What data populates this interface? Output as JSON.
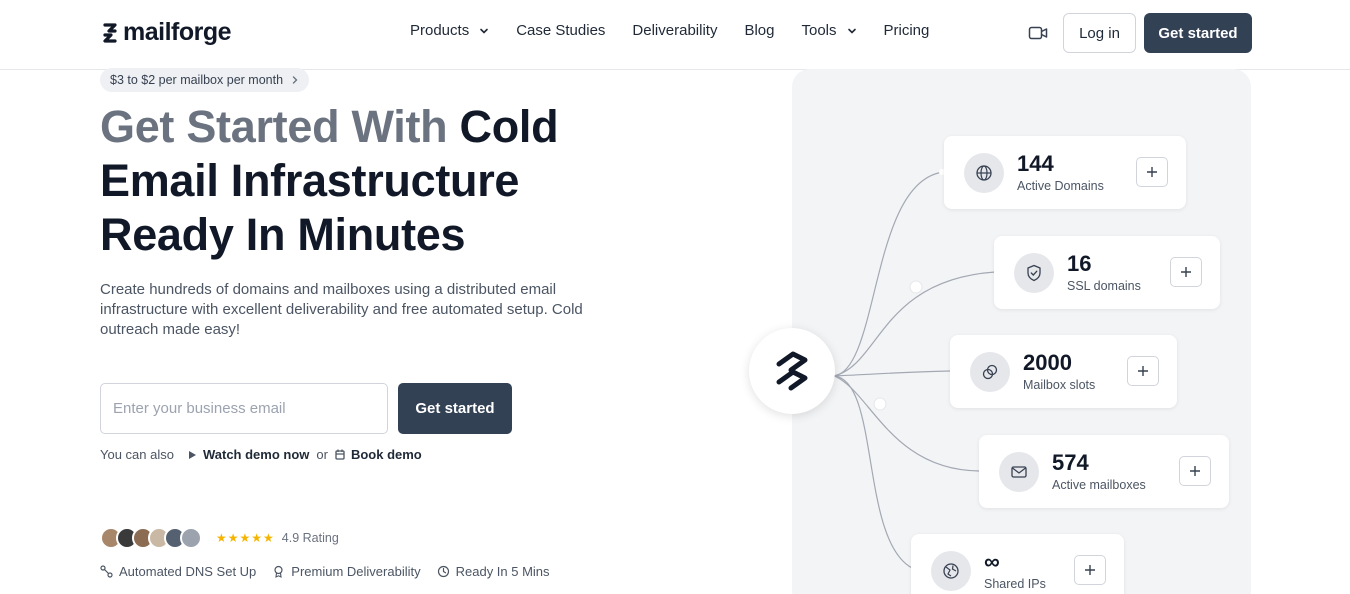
{
  "brand": {
    "name": "mailforge"
  },
  "nav": {
    "items": [
      {
        "label": "Products",
        "has_dropdown": true
      },
      {
        "label": "Case Studies",
        "has_dropdown": false
      },
      {
        "label": "Deliverability",
        "has_dropdown": false
      },
      {
        "label": "Blog",
        "has_dropdown": false
      },
      {
        "label": "Tools",
        "has_dropdown": true
      },
      {
        "label": "Pricing",
        "has_dropdown": false
      }
    ],
    "video_icon": "video-camera-icon",
    "login_label": "Log in",
    "cta_label": "Get started"
  },
  "hero": {
    "pill_text": "$3 to $2 per mailbox per month",
    "headline_muted": "Get Started With",
    "headline_rest": " Cold Email Infrastructure Ready In Minutes",
    "description": "Create hundreds of domains and mailboxes using a distributed email infrastructure with excellent deliverability and free automated setup. Cold outreach made easy!",
    "email_placeholder": "Enter your business email",
    "cta_label": "Get started",
    "also_text": "You can also",
    "watch_demo": "Watch demo now",
    "or_text": "or",
    "book_demo": "Book demo",
    "rating_text": "4.9 Rating",
    "stars": 5,
    "features": [
      {
        "icon": "dns-setup-icon",
        "label": "Automated DNS Set Up"
      },
      {
        "icon": "award-icon",
        "label": "Premium Deliverability"
      },
      {
        "icon": "clock-icon",
        "label": "Ready In 5 Mins"
      }
    ]
  },
  "stats": [
    {
      "icon": "globe-icon",
      "value": "144",
      "label": "Active Domains"
    },
    {
      "icon": "shield-check-icon",
      "value": "16",
      "label": "SSL domains"
    },
    {
      "icon": "mailbox-slots-icon",
      "value": "2000",
      "label": "Mailbox slots"
    },
    {
      "icon": "envelope-icon",
      "value": "574",
      "label": "Active mailboxes"
    },
    {
      "icon": "network-globe-icon",
      "value": "∞",
      "label": "Shared IPs"
    }
  ],
  "colors": {
    "primary": "#334155",
    "muted_heading": "#6b7280",
    "star": "#f5b400",
    "panel_bg": "#f3f4f6"
  }
}
